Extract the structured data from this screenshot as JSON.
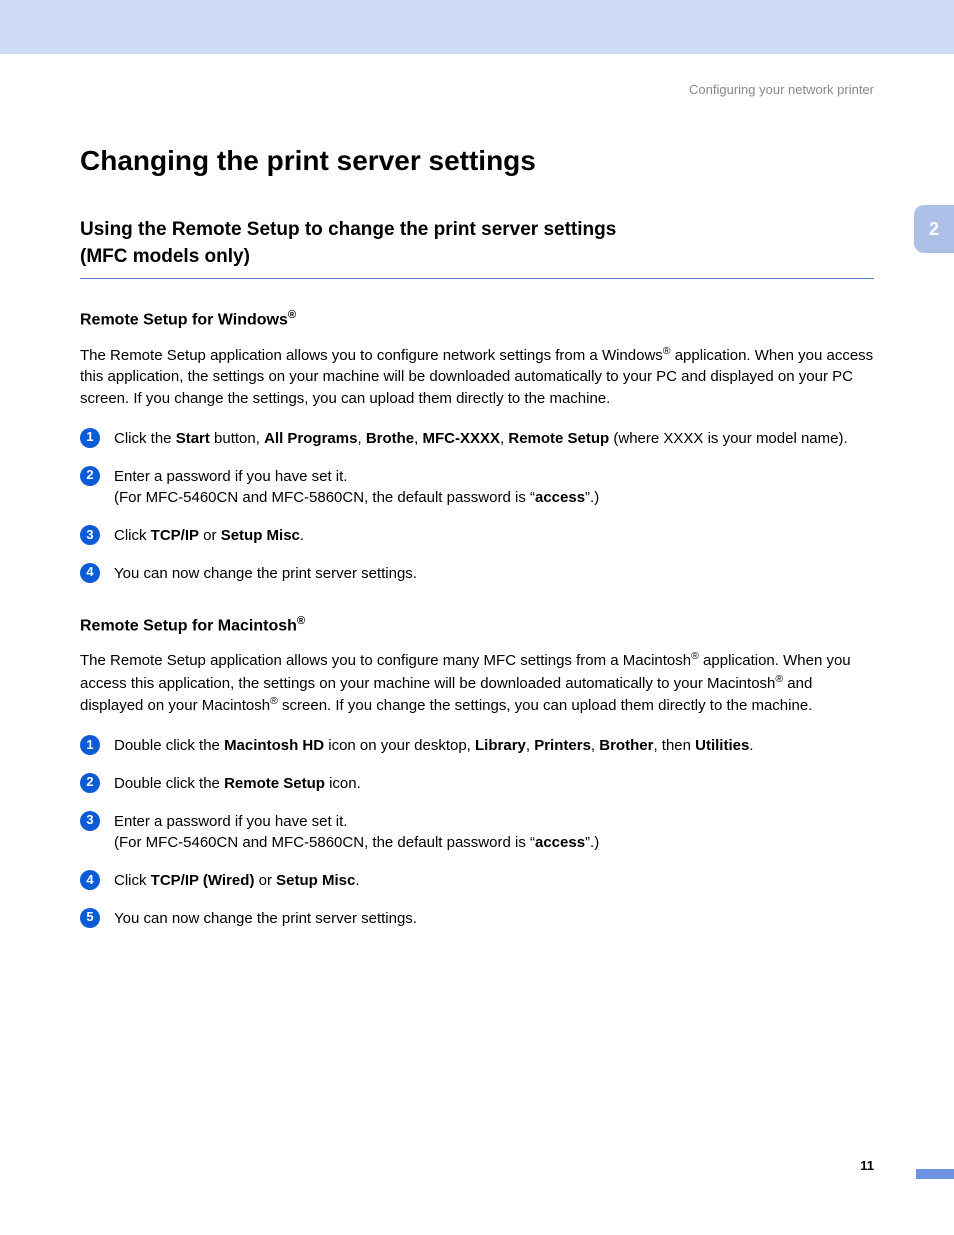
{
  "header": {
    "label": "Configuring your network printer"
  },
  "sideTab": {
    "chapter": "2"
  },
  "title": "Changing the print server settings",
  "section": {
    "heading_l1": "Using the Remote Setup to change the print server settings",
    "heading_l2": "(MFC models only)"
  },
  "windows": {
    "heading_prefix": "Remote Setup for Windows",
    "paragraph": {
      "p1": "The Remote Setup application allows you to configure network settings from a Windows",
      "p2": " application. When you access this application, the settings on your machine will be downloaded automatically to your PC and displayed on your PC screen. If you change the settings, you can upload them directly to the machine."
    },
    "steps": [
      {
        "n": "1",
        "pre": "Click the ",
        "b1": "Start",
        "t1": " button, ",
        "b2": "All Programs",
        "t2": ", ",
        "b3": "Brothe",
        "t3": ", ",
        "b4": "MFC-XXXX",
        "t4": ", ",
        "b5": "Remote Setup",
        "t5": " (where XXXX is your model name)."
      },
      {
        "n": "2",
        "line1": "Enter a password if you have set it.",
        "line2a": "(For MFC-5460CN and MFC-5860CN, the default password is “",
        "line2b": "access",
        "line2c": "”.)"
      },
      {
        "n": "3",
        "pre": "Click ",
        "b1": "TCP/IP",
        "mid": " or ",
        "b2": "Setup Misc",
        "post": "."
      },
      {
        "n": "4",
        "text": "You can now change the print server settings."
      }
    ]
  },
  "mac": {
    "heading_prefix": "Remote Setup for Macintosh",
    "paragraph": {
      "p1": "The Remote Setup application allows you to configure many MFC settings from a Macintosh",
      "p2": " application. When you access this application, the settings on your machine will be downloaded automatically to your Macintosh",
      "p3": " and displayed on your Macintosh",
      "p4": " screen. If you change the settings, you can upload them directly to the machine."
    },
    "steps": [
      {
        "n": "1",
        "pre": "Double click the ",
        "b1": "Macintosh HD",
        "t1": " icon on your desktop, ",
        "b2": "Library",
        "t2": ", ",
        "b3": "Printers",
        "t3": ", ",
        "b4": "Brother",
        "t4": ", then ",
        "b5": "Utilities",
        "t5": "."
      },
      {
        "n": "2",
        "pre": "Double click the ",
        "b1": "Remote Setup",
        "post": " icon."
      },
      {
        "n": "3",
        "line1": "Enter a password if you have set it.",
        "line2a": "(For MFC-5460CN and MFC-5860CN, the default password is “",
        "line2b": "access",
        "line2c": "”.)"
      },
      {
        "n": "4",
        "pre": "Click ",
        "b1": "TCP/IP (Wired)",
        "mid": " or ",
        "b2": "Setup Misc",
        "post": "."
      },
      {
        "n": "5",
        "text": "You can now change the print server settings."
      }
    ]
  },
  "pageNumber": "11",
  "reg": "®"
}
